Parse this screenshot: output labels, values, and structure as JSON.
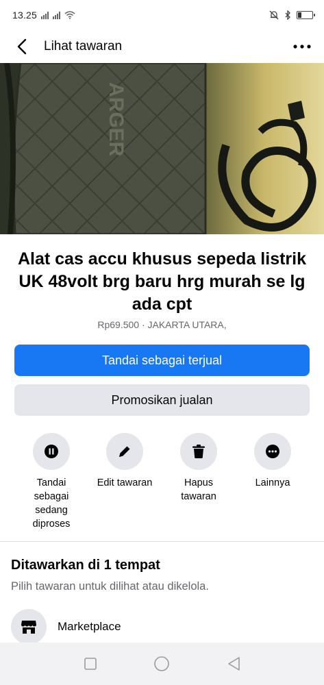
{
  "status_bar": {
    "time": "13.25",
    "battery_level": 0.25
  },
  "header": {
    "title": "Lihat tawaran",
    "back_icon": "chevron-left-icon",
    "more_icon": "more-horizontal-icon"
  },
  "photo": {
    "image_count": 6,
    "active_index": 0
  },
  "listing": {
    "title": "Alat cas accu khusus sepeda listrik UK 48volt brg baru hrg murah se lg ada cpt",
    "meta": "Rp69.500 · JAKARTA UTARA,"
  },
  "buttons": {
    "mark_sold": "Tandai sebagai terjual",
    "promote": "Promosikan jualan"
  },
  "actions": [
    {
      "label": "Tandai sebagai sedang diproses",
      "icon": "pause-icon"
    },
    {
      "label": "Edit tawaran",
      "icon": "pencil-icon"
    },
    {
      "label": "Hapus tawaran",
      "icon": "trash-icon"
    },
    {
      "label": "Lainnya",
      "icon": "more-horizontal-icon"
    }
  ],
  "offered": {
    "title": "Ditawarkan di 1 tempat",
    "subtitle": "Pilih tawaran untuk dilihat atau dikelola.",
    "places": [
      {
        "label": "Marketplace",
        "icon": "storefront-icon"
      }
    ]
  },
  "colors": {
    "primary": "#1877f2",
    "secondary_bg": "#e4e6eb",
    "muted_text": "#65676b"
  }
}
